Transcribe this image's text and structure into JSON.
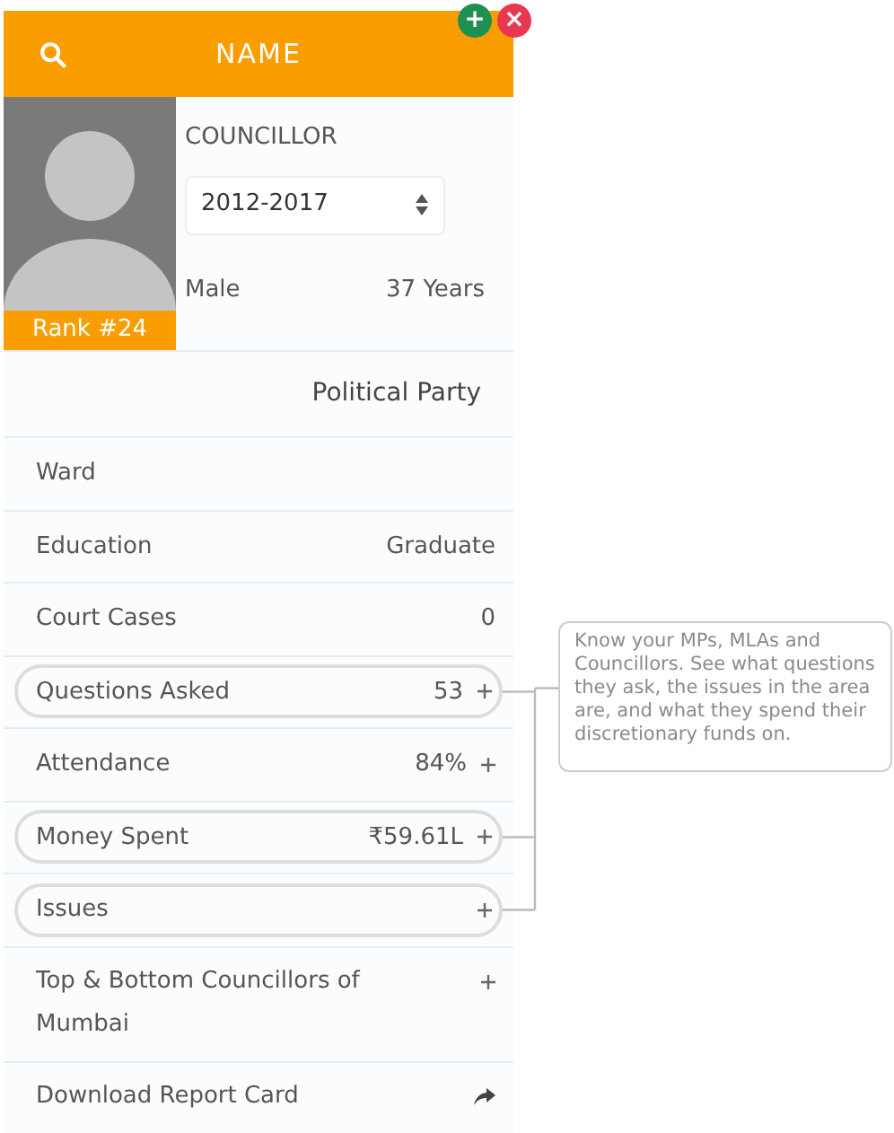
{
  "header": {
    "title": "NAME"
  },
  "window_buttons": [
    {
      "kind": "add",
      "label": "+"
    },
    {
      "kind": "close",
      "label": "×"
    }
  ],
  "profile": {
    "rank": "Rank #24",
    "role": "COUNCILLOR",
    "term": "2012-2017",
    "gender": "Male",
    "age": "37 Years"
  },
  "party": "Political Party",
  "rows": [
    {
      "label": "Ward",
      "value": "",
      "highlighted": false,
      "plus": false
    },
    {
      "label": "Education",
      "value": "Graduate",
      "highlighted": false,
      "plus": false
    },
    {
      "label": "Court Cases",
      "value": "0",
      "highlighted": false,
      "plus": false
    },
    {
      "label": "Questions Asked",
      "value": "53",
      "highlighted": true,
      "plus": true
    },
    {
      "label": "Attendance",
      "value": "84%",
      "highlighted": false,
      "plus": true
    },
    {
      "label": "Money Spent",
      "value": "₹59.61L",
      "highlighted": true,
      "plus": true
    },
    {
      "label": "Issues",
      "value": "",
      "highlighted": true,
      "plus": true
    },
    {
      "label": "Top & Bottom Councillors of Mumbai",
      "value": "",
      "highlighted": false,
      "plus": true
    }
  ],
  "download": {
    "label": "Download Report Card"
  },
  "tooltip": "Know your MPs, MLAs and Councillors. See what questions they ask, the issues in the area are, and what they spend their discretionary funds on."
}
